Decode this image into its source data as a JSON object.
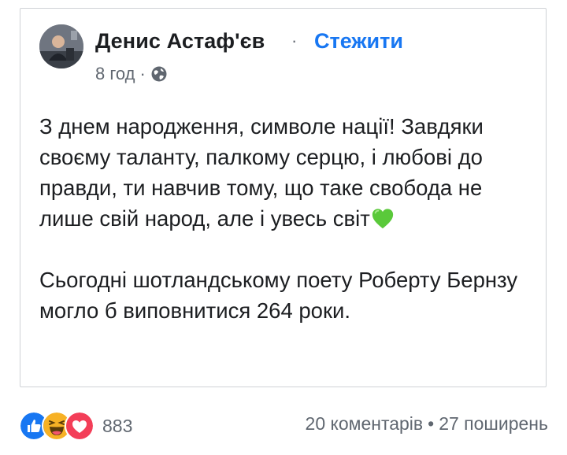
{
  "post": {
    "author": "Денис Астаф'єв",
    "separator": "·",
    "follow_label": "Стежити",
    "time": "8 год",
    "time_separator": "·",
    "privacy_icon": "globe-icon",
    "paragraphs": [
      "З днем народження, символе нації! Завдяки своєму таланту, палкому серцю, і любові до правди, ти навчив тому, що таке свобода не лише свій народ, але і увесь світ",
      "Сьогодні шотландському поету Роберту Бернзу могло б виповнитися 264 роки."
    ],
    "emoji_icon": "green-heart-icon"
  },
  "footer": {
    "reaction_icons": [
      "like-icon",
      "haha-icon",
      "love-icon"
    ],
    "reaction_count": "883",
    "comments": "20 коментарів",
    "stats_separator": "•",
    "shares": "27 поширень"
  },
  "colors": {
    "link": "#1877f2",
    "secondary_text": "#606770",
    "border": "#cfd2d6",
    "like": "#1877f2",
    "love": "#f33e58",
    "haha": "#f7b125",
    "green_heart": "#5ac93a"
  }
}
